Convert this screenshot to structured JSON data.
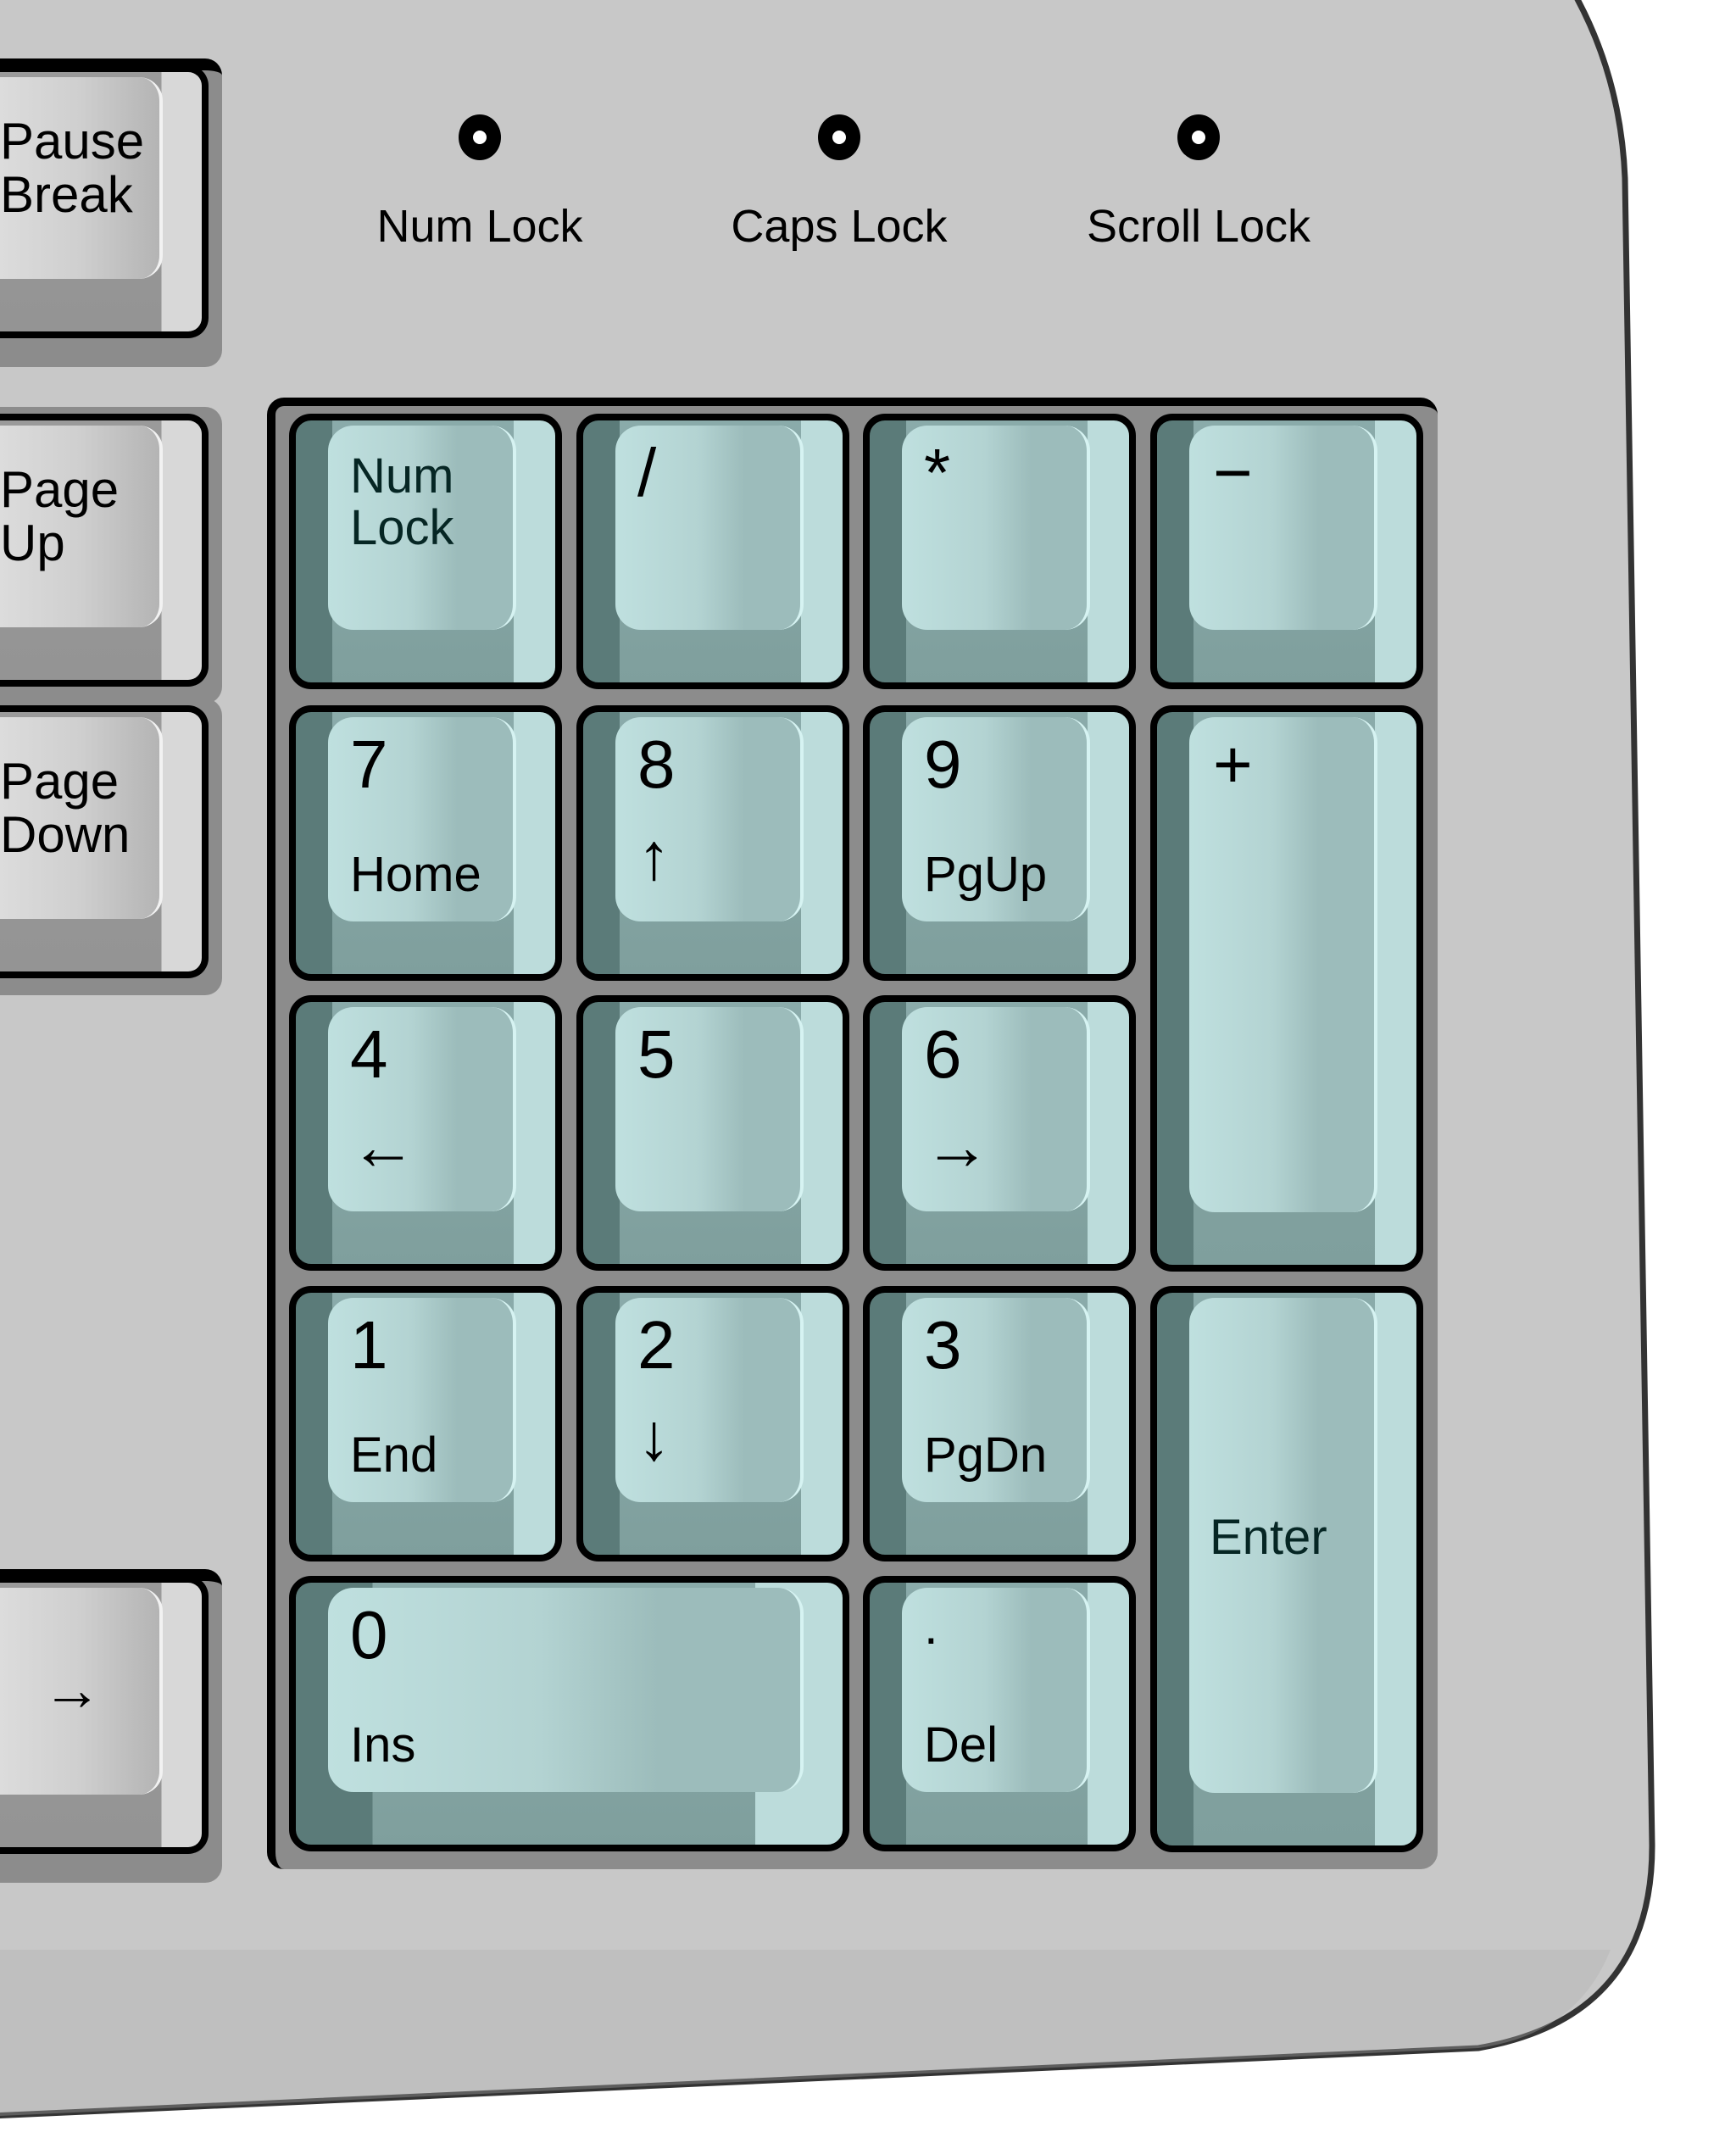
{
  "colors": {
    "body": "#c8c8c8",
    "outline": "#333333",
    "key_cap": "#bfe0df",
    "key_side": "#5b7b79",
    "gray_key_cap": "#dcdcdc"
  },
  "indicators": [
    {
      "label": "Num Lock",
      "icon": "led-icon"
    },
    {
      "label": "Caps Lock",
      "icon": "led-icon"
    },
    {
      "label": "Scroll Lock",
      "icon": "led-icon"
    }
  ],
  "side_keys": [
    {
      "label": "Pause\nBreak"
    },
    {
      "label": "Page\nUp"
    },
    {
      "label": "Page\nDown"
    },
    {
      "label": "→",
      "icon": "right-arrow-icon"
    }
  ],
  "numpad": [
    {
      "label": "Num\nLock",
      "sub": ""
    },
    {
      "label": "/",
      "sub": ""
    },
    {
      "label": "*",
      "sub": ""
    },
    {
      "label": "−",
      "sub": ""
    },
    {
      "label": "7",
      "sub": "Home"
    },
    {
      "label": "8",
      "sub": "↑",
      "icon": "up-arrow-icon"
    },
    {
      "label": "9",
      "sub": "PgUp"
    },
    {
      "label": "+",
      "sub": ""
    },
    {
      "label": "4",
      "sub": "←",
      "icon": "left-arrow-icon"
    },
    {
      "label": "5",
      "sub": ""
    },
    {
      "label": "6",
      "sub": "→",
      "icon": "right-arrow-icon"
    },
    {
      "label": "1",
      "sub": "End"
    },
    {
      "label": "2",
      "sub": "↓",
      "icon": "down-arrow-icon"
    },
    {
      "label": "3",
      "sub": "PgDn"
    },
    {
      "label": "Enter",
      "sub": ""
    },
    {
      "label": "0",
      "sub": "Ins"
    },
    {
      "label": ".",
      "sub": "Del"
    }
  ]
}
